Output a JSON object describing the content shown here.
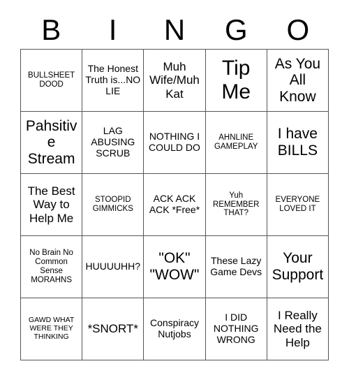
{
  "card": {
    "title": "BINGO",
    "header_letters": [
      "B",
      "I",
      "N",
      "G",
      "O"
    ],
    "colors": {
      "background": "#ffffff",
      "text": "#000000",
      "grid_line": "#555555"
    },
    "grid_size": "5x5",
    "free_space_index": 12,
    "rows": [
      [
        {
          "text": "BULLSHEET DOOD",
          "size": "s"
        },
        {
          "text": "The Honest Truth is...NO LIE",
          "size": "m"
        },
        {
          "text": "Muh Wife/Muh Kat",
          "size": "l"
        },
        {
          "text": "Tip Me",
          "size": "xxl"
        },
        {
          "text": "As You All Know",
          "size": "xl"
        }
      ],
      [
        {
          "text": "Pahsitive Stream",
          "size": "xl"
        },
        {
          "text": "LAG ABUSING SCRUB",
          "size": "m"
        },
        {
          "text": "NOTHING I COULD DO",
          "size": "m"
        },
        {
          "text": "AHNLINE GAMEPLAY",
          "size": "s"
        },
        {
          "text": "I have BILLS",
          "size": "xl"
        }
      ],
      [
        {
          "text": "The Best Way to Help Me",
          "size": "l"
        },
        {
          "text": "STOOPID GIMMICKS",
          "size": "s"
        },
        {
          "text": "ACK ACK ACK *Free*",
          "size": "m"
        },
        {
          "text": "Yuh REMEMBER THAT?",
          "size": "s"
        },
        {
          "text": "EVERYONE LOVED IT",
          "size": "s"
        }
      ],
      [
        {
          "text": "No Brain No Common Sense MORAHNS",
          "size": "s"
        },
        {
          "text": "HUUUUHH?",
          "size": "m"
        },
        {
          "text": "\"OK\" \"WOW\"",
          "size": "xl"
        },
        {
          "text": "These Lazy Game Devs",
          "size": "m"
        },
        {
          "text": "Your Support",
          "size": "xl"
        }
      ],
      [
        {
          "text": "GAWD WHAT WERE THEY THINKING",
          "size": "xs"
        },
        {
          "text": "*SNORT*",
          "size": "l"
        },
        {
          "text": "Conspiracy Nutjobs",
          "size": "m"
        },
        {
          "text": "I DID NOTHING WRONG",
          "size": "m"
        },
        {
          "text": "I Really Need the Help",
          "size": "l"
        }
      ]
    ]
  }
}
